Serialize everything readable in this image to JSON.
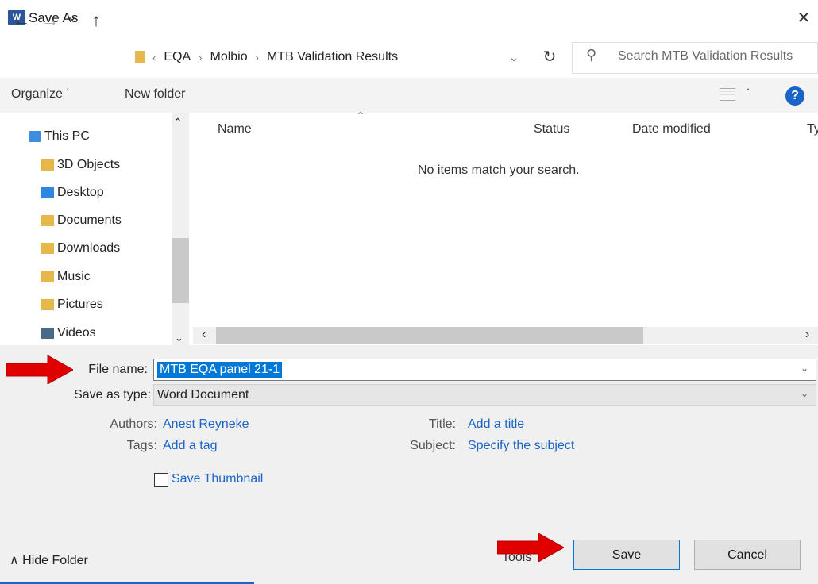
{
  "window": {
    "title": "Save As",
    "close_glyph": "✕",
    "app_icon_letter": "W"
  },
  "nav": {
    "back_glyph": "←",
    "forward_glyph": "→",
    "recent_glyph": "⌄",
    "up_glyph": "↑",
    "breadcrumbs": [
      "EQA",
      "Molbio",
      "MTB Validation Results"
    ],
    "breadcrumb_sep": "›",
    "refresh_glyph": "↻",
    "dropdown_glyph": "⌄"
  },
  "search": {
    "placeholder": "Search MTB Validation Results",
    "icon": "search-icon"
  },
  "toolbar": {
    "organize": "Organize ˙",
    "new_folder": "New folder",
    "view_dot": "˙",
    "help": "?"
  },
  "sidebar": {
    "items": [
      {
        "label": "This PC",
        "icon": "computer-icon",
        "color": "#3c8fe0"
      },
      {
        "label": "3D Objects",
        "icon": "3d-objects-icon",
        "color": "#4aa0e6"
      },
      {
        "label": "Desktop",
        "icon": "desktop-folder-icon",
        "color": "#2f88e0"
      },
      {
        "label": "Documents",
        "icon": "documents-icon",
        "color": "#b4cfe8"
      },
      {
        "label": "Downloads",
        "icon": "downloads-icon",
        "color": "#2f88e0"
      },
      {
        "label": "Music",
        "icon": "music-icon",
        "color": "#f0c040"
      },
      {
        "label": "Pictures",
        "icon": "pictures-icon",
        "color": "#7ab0e0"
      },
      {
        "label": "Videos",
        "icon": "videos-icon",
        "color": "#4a6a8a"
      }
    ]
  },
  "file_list": {
    "columns": [
      "Name",
      "Status",
      "Date modified",
      "Ty"
    ],
    "empty_message": "No items match your search."
  },
  "form": {
    "file_name_label": "File name:",
    "file_name_value": "MTB EQA panel 21-1",
    "save_as_type_label": "Save as type:",
    "save_as_type_value": "Word Document",
    "authors_label": "Authors:",
    "authors_value": "Anest Reyneke",
    "tags_label": "Tags:",
    "tags_value": "Add a tag",
    "title_label": "Title:",
    "title_value": "Add a title",
    "subject_label": "Subject:",
    "subject_value": "Specify the subject",
    "save_thumbnail_label": "Save Thumbnail"
  },
  "footer": {
    "hide_folders": "Hide Folder",
    "hide_folders_glyph": "∧",
    "tools": "Tools",
    "save": "Save",
    "cancel": "Cancel"
  },
  "colors": {
    "accent": "#0078d7",
    "link": "#1a64c8",
    "arrow": "#e00000"
  }
}
